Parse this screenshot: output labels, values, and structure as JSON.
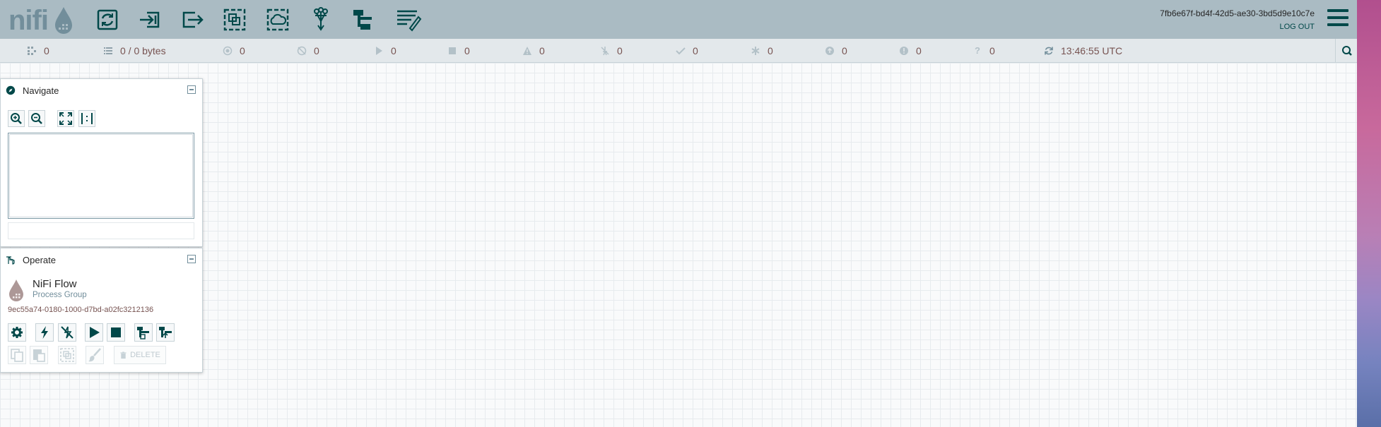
{
  "header": {
    "logo_text": "nifi",
    "user": "7fb6e67f-bd4f-42d5-ae30-3bd5d9e10c7e",
    "logout": "LOG OUT",
    "toolbar_icons": [
      "processor-icon",
      "input-port-icon",
      "output-port-icon",
      "process-group-icon",
      "remote-process-group-icon",
      "funnel-icon",
      "template-icon",
      "label-icon"
    ]
  },
  "status": {
    "active_threads": "0",
    "queued": "0 / 0 bytes",
    "transmitting": "0",
    "not_transmitting": "0",
    "running": "0",
    "stopped": "0",
    "invalid": "0",
    "disabled": "0",
    "up_to_date": "0",
    "locally_modified": "0",
    "stale": "0",
    "locally_modified_stale": "0",
    "sync_failure": "0",
    "refresh_time": "13:46:55 UTC"
  },
  "navigate": {
    "title": "Navigate"
  },
  "operate": {
    "title": "Operate",
    "name": "NiFi Flow",
    "type": "Process Group",
    "id": "9ec55a74-0180-1000-d7bd-a02fc3212136",
    "delete_label": "DELETE"
  },
  "colors": {
    "header_bg": "#aabbc3",
    "accent": "#004849",
    "value_text": "#775351",
    "status_bg": "#e3e8eb"
  }
}
